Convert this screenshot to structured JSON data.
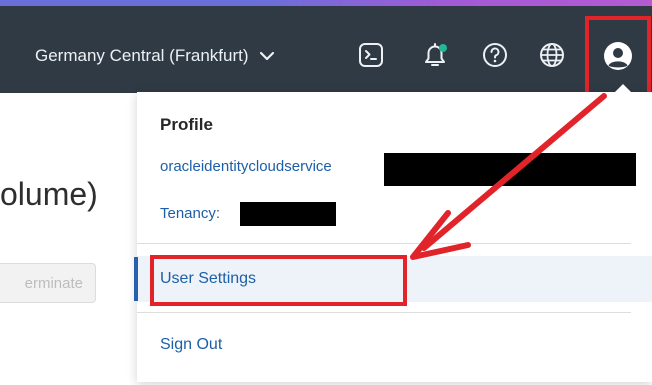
{
  "topbar": {
    "region_label": "Germany Central (Frankfurt)",
    "icons": [
      "cloud-shell-icon",
      "bell-icon",
      "help-icon",
      "globe-icon",
      "profile-icon"
    ],
    "notification_dot_color": "#21b797",
    "background": "#2f3a45"
  },
  "page": {
    "title_fragment": "olume)",
    "terminate_label": "erminate"
  },
  "profile_menu": {
    "heading": "Profile",
    "username": "oracleidentitycloudservice",
    "tenancy_label": "Tenancy:",
    "items": [
      {
        "label": "User Settings"
      },
      {
        "label": "Sign Out"
      }
    ]
  },
  "annotation": {
    "color": "#e0242a"
  }
}
